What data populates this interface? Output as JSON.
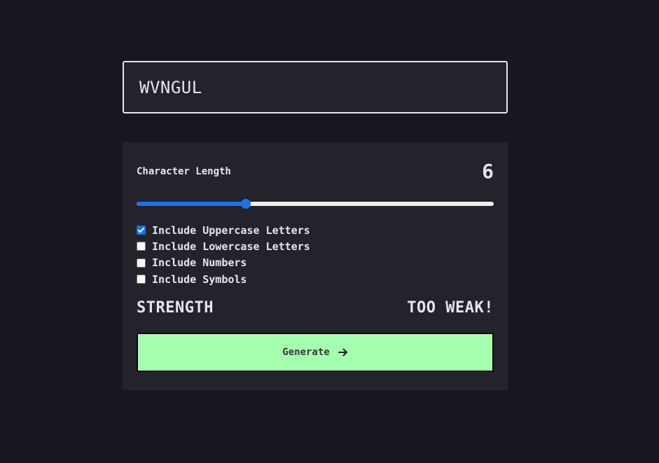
{
  "password": {
    "value": "WVNGUL"
  },
  "settings": {
    "length_label": "Character Length",
    "length_value": "6",
    "slider": {
      "min": 0,
      "max": 20,
      "value": 6.1,
      "fill_color": "#1a73e8",
      "track_color": "#efefef"
    },
    "options": [
      {
        "label": "Include Uppercase Letters",
        "checked": true
      },
      {
        "label": "Include Lowercase Letters",
        "checked": false
      },
      {
        "label": "Include Numbers",
        "checked": false
      },
      {
        "label": "Include Symbols",
        "checked": false
      }
    ]
  },
  "strength": {
    "label": "STRENGTH",
    "value": "TOO WEAK!"
  },
  "generate": {
    "label": "Generate",
    "icon": "arrow-right-icon"
  },
  "colors": {
    "background": "#18171f",
    "panel": "#24232c",
    "text": "#e6e5ea",
    "accent_green": "#a4ffaf"
  }
}
